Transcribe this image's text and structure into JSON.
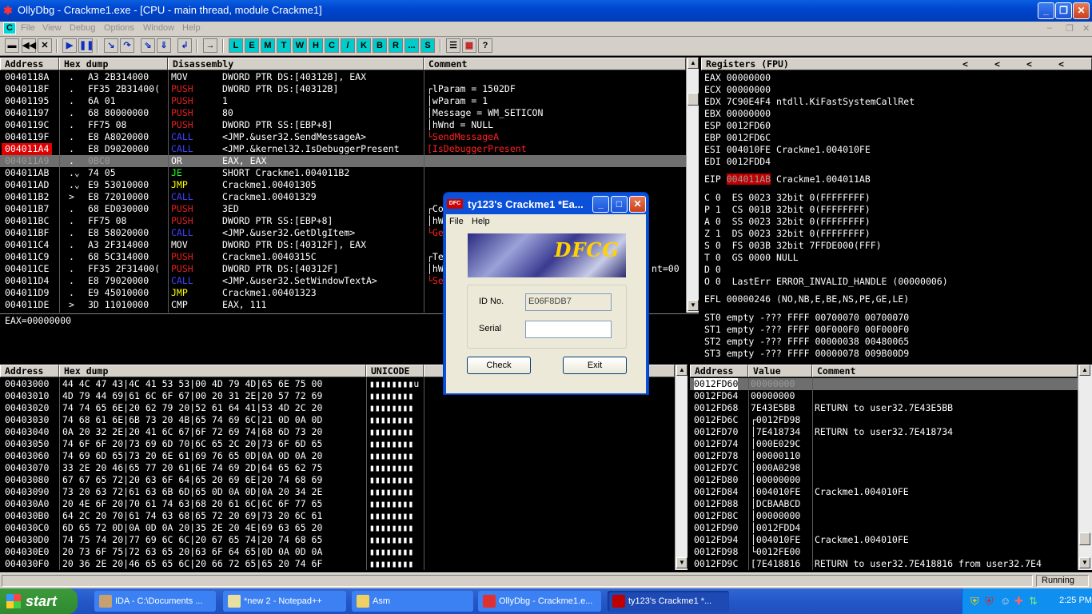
{
  "window": {
    "title": "OllyDbg - Crackme1.exe - [CPU - main thread, module Crackme1]"
  },
  "menu": {
    "c": "C",
    "items": [
      "File",
      "View",
      "Debug",
      "Options",
      "Window",
      "Help"
    ]
  },
  "toolbar": {
    "letters": [
      "L",
      "E",
      "M",
      "T",
      "W",
      "H",
      "C",
      "/",
      "K",
      "B",
      "R",
      "...",
      "S"
    ]
  },
  "disasm": {
    "headers": {
      "address": "Address",
      "hex": "Hex dump",
      "disasm": "Disassembly",
      "comment": "Comment"
    },
    "rows": [
      {
        "addr": "0040118A",
        "mark": ".",
        "hex": "A3 2B314000",
        "mn": "MOV",
        "op": "DWORD PTR DS:[40312B], EAX",
        "cm": "",
        "cls": ""
      },
      {
        "addr": "0040118F",
        "mark": ".",
        "hex": "FF35 2B31400(",
        "mn": "PUSH",
        "op": "DWORD PTR DS:[40312B]",
        "cm": "┌lParam = 1502DF",
        "cls": "push"
      },
      {
        "addr": "00401195",
        "mark": ".",
        "hex": "6A 01",
        "mn": "PUSH",
        "op": "1",
        "cm": "│wParam = 1",
        "cls": "push"
      },
      {
        "addr": "00401197",
        "mark": ".",
        "hex": "68 80000000",
        "mn": "PUSH",
        "op": "80",
        "cm": "│Message = WM_SETICON",
        "cls": "push"
      },
      {
        "addr": "0040119C",
        "mark": ".",
        "hex": "FF75 08",
        "mn": "PUSH",
        "op": "DWORD PTR SS:[EBP+8]",
        "cm": "│hWnd = NULL",
        "cls": "push"
      },
      {
        "addr": "0040119F",
        "mark": ".",
        "hex": "E8 A8020000",
        "mn": "CALL",
        "op": "<JMP.&user32.SendMessageA>",
        "cm": "└SendMessageA",
        "cls": "call"
      },
      {
        "addr": "004011A4",
        "mark": ".",
        "hex": "E8 D9020000",
        "mn": "CALL",
        "op": "<JMP.&kernel32.IsDebuggerPresent",
        "cm": "[IsDebuggerPresent",
        "cls": "call"
      },
      {
        "addr": "004011A9",
        "mark": ".",
        "hex": "0BC0",
        "mn": "OR",
        "op": "EAX, EAX",
        "cm": "",
        "cls": ""
      },
      {
        "addr": "004011AB",
        "mark": ".⌄",
        "hex": "74 05",
        "mn": "JE",
        "op": "SHORT Crackme1.004011B2",
        "cm": "",
        "cls": "je"
      },
      {
        "addr": "004011AD",
        "mark": ".⌄",
        "hex": "E9 53010000",
        "mn": "JMP",
        "op": "Crackme1.00401305",
        "cm": "",
        "cls": "jmp"
      },
      {
        "addr": "004011B2",
        "mark": ">",
        "hex": "E8 72010000",
        "mn": "CALL",
        "op": "Crackme1.00401329",
        "cm": "",
        "cls": "call"
      },
      {
        "addr": "004011B7",
        "mark": ".",
        "hex": "68 ED030000",
        "mn": "PUSH",
        "op": "3ED",
        "cm": "┌Co",
        "cls": "push"
      },
      {
        "addr": "004011BC",
        "mark": ".",
        "hex": "FF75 08",
        "mn": "PUSH",
        "op": "DWORD PTR SS:[EBP+8]",
        "cm": "│hW",
        "cls": "push"
      },
      {
        "addr": "004011BF",
        "mark": ".",
        "hex": "E8 58020000",
        "mn": "CALL",
        "op": "<JMP.&user32.GetDlgItem>",
        "cm": "└Ge",
        "cls": "call"
      },
      {
        "addr": "004011C4",
        "mark": ".",
        "hex": "A3 2F314000",
        "mn": "MOV",
        "op": "DWORD PTR DS:[40312F], EAX",
        "cm": "",
        "cls": ""
      },
      {
        "addr": "004011C9",
        "mark": ".",
        "hex": "68 5C314000",
        "mn": "PUSH",
        "op": "Crackme1.0040315C",
        "cm": "┌Te",
        "cls": "push"
      },
      {
        "addr": "004011CE",
        "mark": ".",
        "hex": "FF35 2F31400(",
        "mn": "PUSH",
        "op": "DWORD PTR DS:[40312F]",
        "cm": "│hW",
        "cls": "push"
      },
      {
        "addr": "004011D4",
        "mark": ".",
        "hex": "E8 79020000",
        "mn": "CALL",
        "op": "<JMP.&user32.SetWindowTextA>",
        "cm": "└Se",
        "cls": "call"
      },
      {
        "addr": "004011D9",
        "mark": ".",
        "hex": "E9 45010000",
        "mn": "JMP",
        "op": "Crackme1.00401323",
        "cm": "",
        "cls": "jmp"
      },
      {
        "addr": "004011DE",
        "mark": ">",
        "hex": "3D 11010000",
        "mn": "CMP",
        "op": "EAX, 111",
        "cm": "",
        "cls": ""
      }
    ],
    "comment_tail": "nt=00"
  },
  "info": {
    "text": "EAX=00000000"
  },
  "registers": {
    "header": "Registers (FPU)",
    "arrows": [
      "<",
      "<",
      "<",
      "<"
    ],
    "gp": [
      {
        "n": "EAX",
        "v": "00000000",
        "c": ""
      },
      {
        "n": "ECX",
        "v": "00000000",
        "c": ""
      },
      {
        "n": "EDX",
        "v": "7C90E4F4",
        "c": "ntdll.KiFastSystemCallRet"
      },
      {
        "n": "EBX",
        "v": "00000000",
        "c": ""
      },
      {
        "n": "ESP",
        "v": "0012FD60",
        "c": ""
      },
      {
        "n": "EBP",
        "v": "0012FD6C",
        "c": ""
      },
      {
        "n": "ESI",
        "v": "004010FE",
        "c": "Crackme1.004010FE"
      },
      {
        "n": "EDI",
        "v": "0012FDD4",
        "c": ""
      }
    ],
    "eip": {
      "n": "EIP",
      "v": "004011AB",
      "c": "Crackme1.004011AB"
    },
    "flags": [
      "C 0  ES 0023 32bit 0(FFFFFFFF)",
      "P 1  CS 001B 32bit 0(FFFFFFFF)",
      "A 0  SS 0023 32bit 0(FFFFFFFF)",
      "Z 1  DS 0023 32bit 0(FFFFFFFF)",
      "S 0  FS 003B 32bit 7FFDE000(FFF)",
      "T 0  GS 0000 NULL",
      "D 0",
      "O 0  LastErr ERROR_INVALID_HANDLE (00000006)"
    ],
    "efl": "EFL 00000246 (NO,NB,E,BE,NS,PE,GE,LE)",
    "fpu": [
      "ST0 empty -??? FFFF 00700070 00700070",
      "ST1 empty -??? FFFF 00F000F0 00F000F0",
      "ST2 empty -??? FFFF 00000038 00480065",
      "ST3 empty -??? FFFF 00000078 009B00D9"
    ]
  },
  "dump": {
    "headers": {
      "address": "Address",
      "hex": "Hex dump",
      "unicode": "UNICODE"
    },
    "rows": [
      {
        "a": "00403000",
        "h": "44 4C 47 43|4C 41 53 53|00 4D 79 4D|65 6E 75 00",
        "u": "▮▮▮▮▮▮▮▮u"
      },
      {
        "a": "00403010",
        "h": "4D 79 44 69|61 6C 6F 67|00 20 31 2E|20 57 72 69",
        "u": "▮▮▮▮▮▮▮▮"
      },
      {
        "a": "00403020",
        "h": "74 74 65 6E|20 62 79 20|52 61 64 41|53 4D 2C 20",
        "u": "▮▮▮▮▮▮▮▮"
      },
      {
        "a": "00403030",
        "h": "74 68 61 6E|6B 73 20 4B|65 74 69 6C|21 0D 0A 0D",
        "u": "▮▮▮▮▮▮▮▮"
      },
      {
        "a": "00403040",
        "h": "0A 20 32 2E|20 41 6C 67|6F 72 69 74|68 6D 73 20",
        "u": "▮▮▮▮▮▮▮▮"
      },
      {
        "a": "00403050",
        "h": "74 6F 6F 20|73 69 6D 70|6C 65 2C 20|73 6F 6D 65",
        "u": "▮▮▮▮▮▮▮▮"
      },
      {
        "a": "00403060",
        "h": "74 69 6D 65|73 20 6E 61|69 76 65 0D|0A 0D 0A 20",
        "u": "▮▮▮▮▮▮▮▮"
      },
      {
        "a": "00403070",
        "h": "33 2E 20 46|65 77 20 61|6E 74 69 2D|64 65 62 75",
        "u": "▮▮▮▮▮▮▮▮"
      },
      {
        "a": "00403080",
        "h": "67 67 65 72|20 63 6F 64|65 20 69 6E|20 74 68 69",
        "u": "▮▮▮▮▮▮▮▮"
      },
      {
        "a": "00403090",
        "h": "73 20 63 72|61 63 6B 6D|65 0D 0A 0D|0A 20 34 2E",
        "u": "▮▮▮▮▮▮▮▮"
      },
      {
        "a": "004030A0",
        "h": "20 4E 6F 20|70 61 74 63|68 20 61 6C|6C 6F 77 65",
        "u": "▮▮▮▮▮▮▮▮"
      },
      {
        "a": "004030B0",
        "h": "64 2C 20 70|61 74 63 68|65 72 20 69|73 20 6C 61",
        "u": "▮▮▮▮▮▮▮▮"
      },
      {
        "a": "004030C0",
        "h": "6D 65 72 0D|0A 0D 0A 20|35 2E 20 4E|69 63 65 20",
        "u": "▮▮▮▮▮▮▮▮"
      },
      {
        "a": "004030D0",
        "h": "74 75 74 20|77 69 6C 6C|20 67 65 74|20 74 68 65",
        "u": "▮▮▮▮▮▮▮▮"
      },
      {
        "a": "004030E0",
        "h": "20 73 6F 75|72 63 65 20|63 6F 64 65|0D 0A 0D 0A",
        "u": "▮▮▮▮▮▮▮▮"
      },
      {
        "a": "004030F0",
        "h": "20 36 2E 20|46 65 65 6C|20 66 72 65|65 20 74 6F",
        "u": "▮▮▮▮▮▮▮▮"
      }
    ]
  },
  "stack": {
    "headers": {
      "address": "Address",
      "value": "Value",
      "comment": "Comment"
    },
    "rows": [
      {
        "a": "0012FD60",
        "v": "00000000",
        "c": ""
      },
      {
        "a": "0012FD64",
        "v": "00000000",
        "c": ""
      },
      {
        "a": "0012FD68",
        "v": "7E43E5BB",
        "c": "RETURN to user32.7E43E5BB"
      },
      {
        "a": "0012FD6C",
        "v": "┌0012FD98",
        "c": ""
      },
      {
        "a": "0012FD70",
        "v": "│7E418734",
        "c": "RETURN to user32.7E418734"
      },
      {
        "a": "0012FD74",
        "v": "│000E029C",
        "c": ""
      },
      {
        "a": "0012FD78",
        "v": "│00000110",
        "c": ""
      },
      {
        "a": "0012FD7C",
        "v": "│000A0298",
        "c": ""
      },
      {
        "a": "0012FD80",
        "v": "│00000000",
        "c": ""
      },
      {
        "a": "0012FD84",
        "v": "│004010FE",
        "c": "Crackme1.004010FE"
      },
      {
        "a": "0012FD88",
        "v": "│DCBAABCD",
        "c": ""
      },
      {
        "a": "0012FD8C",
        "v": "│00000000",
        "c": ""
      },
      {
        "a": "0012FD90",
        "v": "│0012FDD4",
        "c": ""
      },
      {
        "a": "0012FD94",
        "v": "│004010FE",
        "c": "Crackme1.004010FE"
      },
      {
        "a": "0012FD98",
        "v": "└0012FE00",
        "c": ""
      },
      {
        "a": "0012FD9C",
        "v": "[7E418816",
        "c": "RETURN to user32.7E418816 from user32.7E4"
      }
    ]
  },
  "dialog": {
    "title": "ty123's Crackme1 *Ea...",
    "menu": [
      "File",
      "Help"
    ],
    "logo": "DFCG",
    "id_label": "ID No.",
    "id_value": "E06F8DB7",
    "serial_label": "Serial",
    "serial_value": "",
    "check": "Check",
    "exit": "Exit"
  },
  "status": {
    "text": "Running"
  },
  "taskbar": {
    "start": "start",
    "tasks": [
      "IDA - C:\\Documents ...",
      "*new  2 - Notepad++",
      "Asm",
      "OllyDbg - Crackme1.e...",
      "ty123's Crackme1 *..."
    ],
    "clock": "2:25 PM"
  }
}
